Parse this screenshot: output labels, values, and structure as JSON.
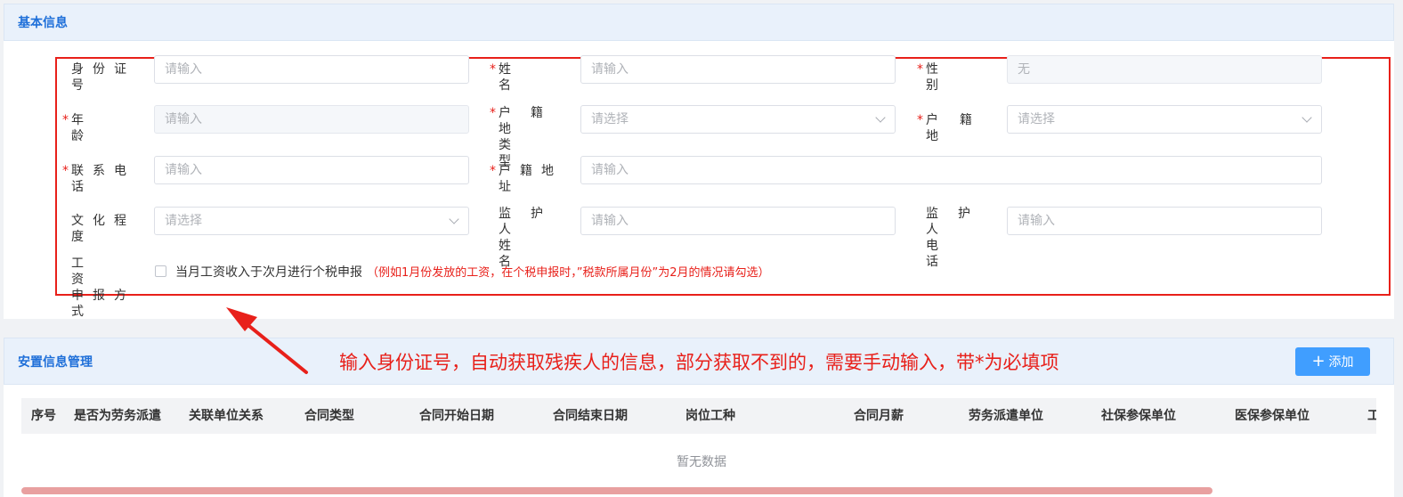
{
  "basic": {
    "title": "基本信息",
    "fields": {
      "id_number": {
        "label": "身份证号",
        "placeholder": "请输入"
      },
      "name": {
        "label": "姓名",
        "placeholder": "请输入"
      },
      "gender": {
        "label": "性别",
        "placeholder": "无"
      },
      "age": {
        "label": "年龄",
        "placeholder": "请输入"
      },
      "hukou_type": {
        "label_line1": "户籍地",
        "label_line2": "类型",
        "placeholder": "请选择"
      },
      "hukou": {
        "label": "户籍地",
        "placeholder": "请选择"
      },
      "phone": {
        "label": "联系电话",
        "placeholder": "请输入"
      },
      "hukou_address": {
        "label": "户籍地址",
        "placeholder": "请输入"
      },
      "education": {
        "label": "文化程度",
        "placeholder": "请选择"
      },
      "guardian_name": {
        "label_line1": "监护人",
        "label_line2": "姓名",
        "placeholder": "请输入"
      },
      "guardian_phone": {
        "label_line1": "监护人",
        "label_line2": "电话",
        "placeholder": "请输入"
      },
      "wage_method": {
        "label_line1": "工资",
        "label_line2": "申报方式"
      }
    },
    "required_mark": "*",
    "checkbox_label": "当月工资收入于次月进行个税申报",
    "checkbox_note": "（例如1月份发放的工资，在个税申报时，”税款所属月份”为2月的情况请勾选）"
  },
  "annotation": "输入身份证号，自动获取残疾人的信息，部分获取不到的，需要手动输入，带*为必填项",
  "placement": {
    "title": "安置信息管理",
    "add_button": "添加",
    "columns": [
      "序号",
      "是否为劳务派遣",
      "关联单位关系",
      "合同类型",
      "合同开始日期",
      "合同结束日期",
      "岗位工种",
      "合同月薪",
      "劳务派遣单位",
      "社保参保单位",
      "医保参保单位",
      "工"
    ],
    "empty_text": "暂无数据"
  },
  "colors": {
    "accent": "#409eff",
    "title_blue": "#1e6fd9",
    "annotation_red": "#e8201a"
  }
}
